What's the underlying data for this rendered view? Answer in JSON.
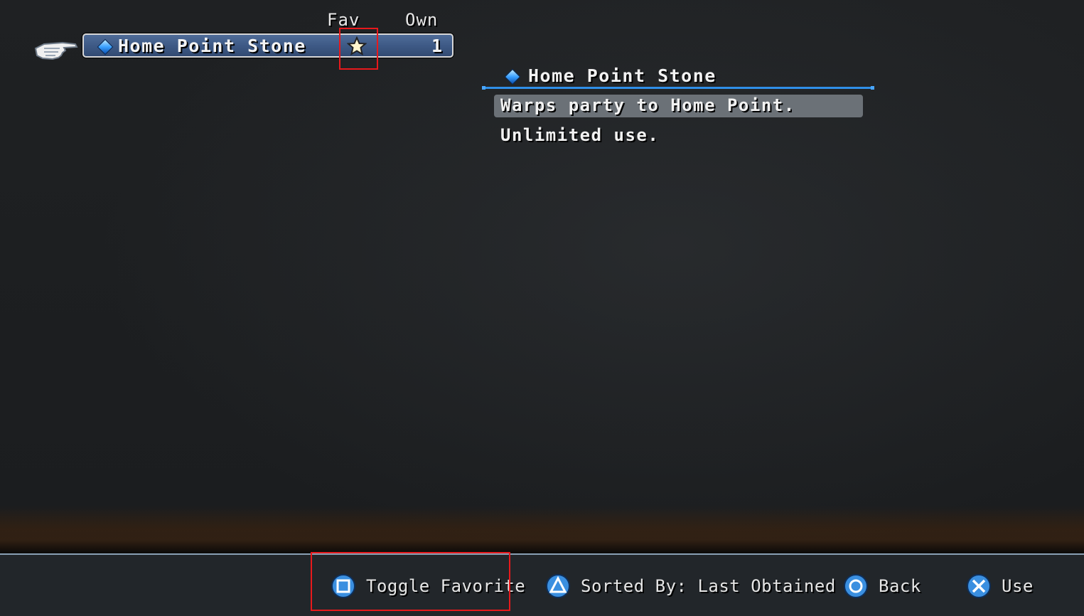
{
  "list": {
    "headers": {
      "fav": "Fav",
      "own": "Own"
    },
    "items": [
      {
        "name": "Home Point Stone",
        "favorite": true,
        "own": "1",
        "selected": true
      }
    ]
  },
  "detail": {
    "title": "Home Point Stone",
    "lines": [
      "Warps party to Home Point.",
      "Unlimited use."
    ]
  },
  "footer": {
    "hints": [
      {
        "icon": "square-button-icon",
        "label": "Toggle Favorite"
      },
      {
        "icon": "triangle-button-icon",
        "label": "Sorted By: Last Obtained"
      },
      {
        "icon": "circle-button-icon",
        "label": "Back"
      },
      {
        "icon": "cross-button-icon",
        "label": "Use"
      }
    ]
  },
  "colors": {
    "row_fill": "#3e5a86",
    "accent_blue": "#2f8fe8",
    "highlight_red": "#e8191c",
    "button_blue": "#3a8fe0"
  }
}
